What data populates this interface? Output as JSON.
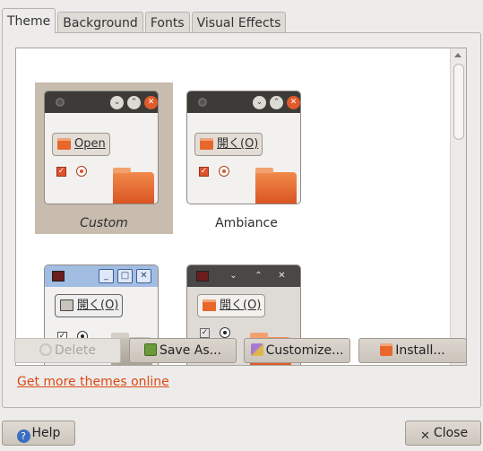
{
  "tabs": [
    "Theme",
    "Background",
    "Fonts",
    "Visual Effects"
  ],
  "themes": [
    {
      "name": "Custom",
      "open_label": "Open",
      "selected": true
    },
    {
      "name": "Ambiance",
      "open_label": "開く(O)",
      "selected": false
    },
    {
      "name": "",
      "open_label": "開く(O)",
      "selected": false
    },
    {
      "name": "",
      "open_label": "開く(O)",
      "selected": false
    }
  ],
  "buttons": {
    "delete": "Delete",
    "save_as": "Save As...",
    "customize": "Customize...",
    "install": "Install..."
  },
  "link": "Get more themes online",
  "footer": {
    "help": "Help",
    "close": "Close"
  },
  "colors": {
    "accent": "#dd4814",
    "selection": "#c8bcae",
    "titlebar_dark": "#3c3b37"
  }
}
